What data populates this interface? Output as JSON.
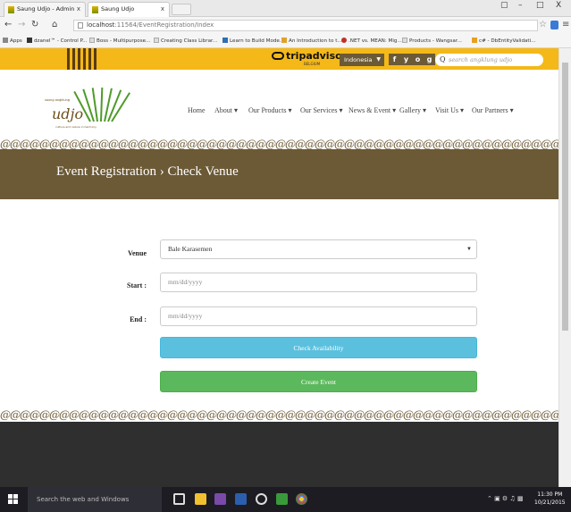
{
  "browser": {
    "tabs": [
      {
        "label": "Saung Udjo - Admin",
        "close": "x"
      },
      {
        "label": "Saung Udjo",
        "close": "x"
      }
    ],
    "window_controls": [
      "–",
      "□",
      "X"
    ],
    "url_host": "localhost",
    "url_path": ":11564/EventRegistration/Index",
    "bookmarks": [
      "Apps",
      "dzanel™ - Control P...",
      "Boss - Multipurpose...",
      "Creating Class Librar...",
      "Learn to Build Mode...",
      "An Introduction to t...",
      ".NET vs. MEAN: Mig...",
      "Products - Wangsar...",
      "c# - DbEntityValidati..."
    ]
  },
  "topbar": {
    "trip_main": "tripadvisor",
    "trip_sub": "BELGIUM",
    "language": "Indonesia",
    "social": [
      "f",
      "y",
      "o",
      "g"
    ],
    "search_placeholder": "search angklung udjo"
  },
  "logo": {
    "small_top": "saung angklung",
    "word": "udjo",
    "small_bottom": "culture and nature in harmony"
  },
  "nav": [
    {
      "label": "Home"
    },
    {
      "label": "About ▾"
    },
    {
      "label": "Our Products ▾"
    },
    {
      "label": "Our Services ▾"
    },
    {
      "label": "News & Event ▾"
    },
    {
      "label": "Gallery ▾"
    },
    {
      "label": "Visit Us ▾"
    },
    {
      "label": "Our Partners ▾"
    }
  ],
  "pattern_text": "@@@@@@@@@@@@@@@@@@@@@@@@@@@@@@@@@@@@@@@@@@@@@@@@@@@@@@@@@@@@@@@@@@@@@@@@@@@@",
  "page_title": "Event Registration › Check Venue",
  "form": {
    "venue_label": "Venue",
    "venue_value": "Bale Karasemen",
    "start_label": "Start :",
    "start_placeholder": "mm/dd/yyyy",
    "end_label": "End :",
    "end_placeholder": "mm/dd/yyyy",
    "check_button": "Check Availability",
    "create_button": "Create Event"
  },
  "taskbar": {
    "search_placeholder": "Search the web and Windows",
    "time": "11:30 PM",
    "date": "10/21/2015"
  },
  "colors": {
    "brand_brown": "#6c5a36",
    "top_yellow": "#f4b818",
    "check_button": "#5bc0de",
    "create_button": "#5cb85c"
  }
}
